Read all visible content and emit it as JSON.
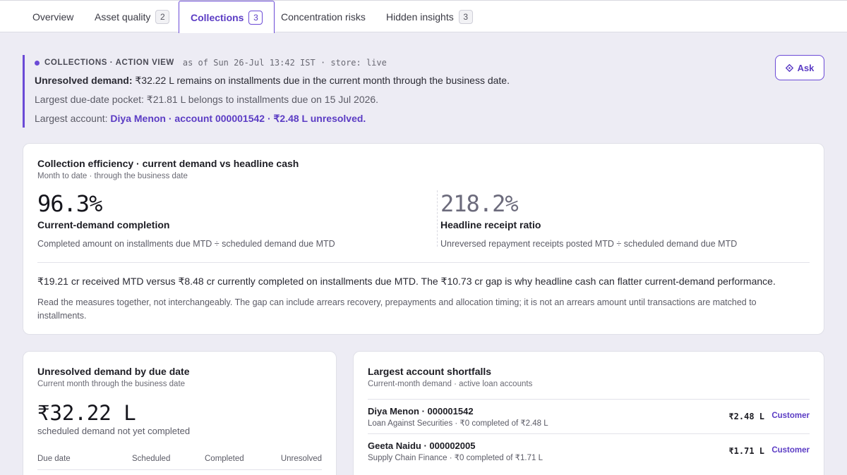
{
  "tabs": [
    {
      "label": "Overview",
      "count": null
    },
    {
      "label": "Asset quality",
      "count": "2"
    },
    {
      "label": "Collections",
      "count": "3"
    },
    {
      "label": "Concentration risks",
      "count": null
    },
    {
      "label": "Hidden insights",
      "count": "3"
    }
  ],
  "banner": {
    "kicker": "COLLECTIONS · ACTION VIEW",
    "asof": "as of Sun 26-Jul 13:42 IST · store: live",
    "line1_label": "Unresolved demand:",
    "line1_text": " ₹32.22 L remains on installments due in the current month through the business date.",
    "line2_label": "Largest due-date pocket:",
    "line2_text": " ₹21.81 L belongs to installments due on 15 Jul 2026.",
    "line3_label": "Largest account:",
    "line3_link": "Diya Menon · account 000001542 · ₹2.48 L unresolved."
  },
  "ask": {
    "label": "Ask"
  },
  "efficiency": {
    "title": "Collection efficiency · current demand vs headline cash",
    "subtitle": "Month to date · through the business date",
    "metric1": {
      "value": "96.3%",
      "name": "Current-demand completion",
      "desc": "Completed amount on installments due MTD ÷ scheduled demand due MTD"
    },
    "metric2": {
      "value": "218.2%",
      "name": "Headline receipt ratio",
      "desc": "Unreversed repayment receipts posted MTD ÷ scheduled demand due MTD"
    },
    "summary": "₹19.21 cr received MTD versus ₹8.48 cr currently completed on installments due MTD. The ₹10.73 cr gap is why headline cash can flatter current-demand performance.",
    "note": "Read the measures together, not interchangeably. The gap can include arrears recovery, prepayments and allocation timing; it is not an arrears amount until transactions are matched to installments."
  },
  "unresolved": {
    "title": "Unresolved demand by due date",
    "subtitle": "Current month through the business date",
    "amount": "₹32.22 L",
    "caption": "scheduled demand not yet completed",
    "columns": [
      "Due date",
      "Scheduled",
      "Completed",
      "Unresolved"
    ]
  },
  "shortfalls": {
    "title": "Largest account shortfalls",
    "subtitle": "Current-month demand · active loan accounts",
    "rows": [
      {
        "name": "Diya Menon · 000001542",
        "meta": "Loan Against Securities · ₹0 completed of ₹2.48 L",
        "amount": "₹2.48 L",
        "link": "Customer"
      },
      {
        "name": "Geeta Naidu · 000002005",
        "meta": "Supply Chain Finance · ₹0 completed of ₹1.71 L",
        "amount": "₹1.71 L",
        "link": "Customer"
      }
    ]
  }
}
